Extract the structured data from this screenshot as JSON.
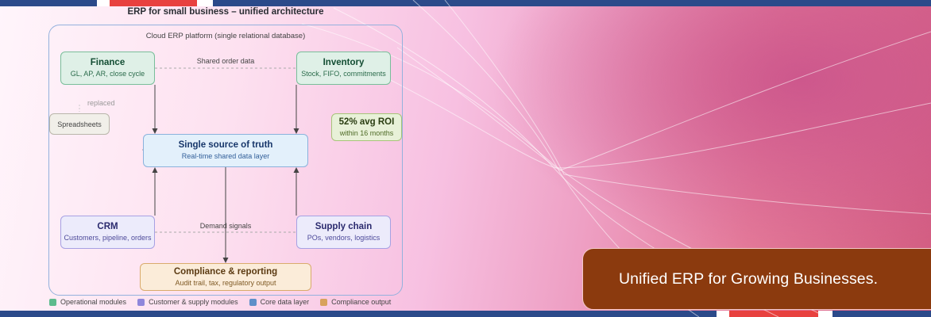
{
  "diagram": {
    "title": "ERP for small business – unified architecture",
    "platform_label": "Cloud ERP platform (single relational database)",
    "nodes": {
      "finance": {
        "title": "Finance",
        "subtitle": "GL, AP, AR, close cycle"
      },
      "inventory": {
        "title": "Inventory",
        "subtitle": "Stock, FIFO, commitments"
      },
      "truth": {
        "title": "Single source of truth",
        "subtitle": "Real-time shared data layer"
      },
      "crm": {
        "title": "CRM",
        "subtitle": "Customers, pipeline, orders"
      },
      "supply": {
        "title": "Supply chain",
        "subtitle": "POs, vendors, logistics"
      },
      "compliance": {
        "title": "Compliance & reporting",
        "subtitle": "Audit trail, tax, regulatory output"
      },
      "spreadsheets": {
        "title": "Spreadsheets"
      },
      "roi": {
        "title": "52% avg ROI",
        "subtitle": "within 16 months"
      }
    },
    "edge_labels": {
      "shared_order_data": "Shared order data",
      "demand_signals": "Demand signals",
      "replaced": "replaced"
    },
    "legend": [
      {
        "label": "Operational modules",
        "color": "#5dbb8d"
      },
      {
        "label": "Customer & supply modules",
        "color": "#8f86db"
      },
      {
        "label": "Core data layer",
        "color": "#5e8fc9"
      },
      {
        "label": "Compliance output",
        "color": "#d8a25d"
      }
    ]
  },
  "cta": {
    "text": "Unified ERP for Growing Businesses."
  },
  "colors": {
    "band": "#2b4a8a",
    "flag_red": "#e8413f",
    "cta_background": "#8b3a0e"
  }
}
